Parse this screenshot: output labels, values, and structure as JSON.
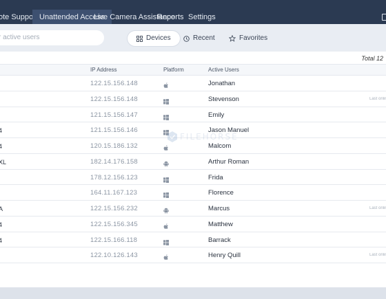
{
  "nav": {
    "tabs": [
      {
        "label": "ote Support"
      },
      {
        "label": "Unattended Access"
      },
      {
        "label": "Live Camera Assistance"
      },
      {
        "label": "Reports"
      },
      {
        "label": "Settings"
      }
    ],
    "active_tab": "Unattended Access"
  },
  "toolbar": {
    "search_placeholder": "r active users",
    "filters": [
      {
        "label": "Devices",
        "icon": "grid-icon",
        "active": true
      },
      {
        "label": "Recent",
        "icon": "clock-icon",
        "active": false
      },
      {
        "label": "Favorites",
        "icon": "star-icon",
        "active": false
      }
    ]
  },
  "summary": {
    "total": "Total 12"
  },
  "table": {
    "headers": {
      "ip": "IP Address",
      "platform": "Platform",
      "user": "Active Users"
    },
    "rows": [
      {
        "name": "",
        "ip": "122.15.156.148",
        "platform": "apple",
        "user": "Jonathan",
        "seen": ""
      },
      {
        "name": "",
        "ip": "122.15.156.148",
        "platform": "windows",
        "user": "Stevenson",
        "seen": "Last online"
      },
      {
        "name": "",
        "ip": "121.15.156.147",
        "platform": "windows",
        "user": "Emily",
        "seen": ""
      },
      {
        "name": "4",
        "ip": "121.15.156.146",
        "platform": "windows",
        "user": "Jason Manuel",
        "seen": ""
      },
      {
        "name": "4",
        "ip": "120.15.186.132",
        "platform": "apple",
        "user": "Malcom",
        "seen": ""
      },
      {
        "name": "XL",
        "ip": "182.14.176.158",
        "platform": "android",
        "user": "Arthur Roman",
        "seen": ""
      },
      {
        "name": "",
        "ip": "178.12.156.123",
        "platform": "windows",
        "user": "Frida",
        "seen": ""
      },
      {
        "name": "",
        "ip": "164.11.167.123",
        "platform": "windows",
        "user": "Florence",
        "seen": ""
      },
      {
        "name": "A",
        "ip": "122.15.156.232",
        "platform": "android",
        "user": "Marcus",
        "seen": "Last online"
      },
      {
        "name": "4",
        "ip": "122.15.156.345",
        "platform": "apple",
        "user": "Matthew",
        "seen": ""
      },
      {
        "name": "4",
        "ip": "122.15.166.118",
        "platform": "windows",
        "user": "Barrack",
        "seen": ""
      },
      {
        "name": "",
        "ip": "122.10.126.143",
        "platform": "apple",
        "user": "Henry Quill",
        "seen": "Last online"
      }
    ]
  },
  "colors": {
    "nav_bg": "#2b3a52",
    "nav_active": "#3d5070",
    "toolbar_bg": "#e9edf3"
  }
}
